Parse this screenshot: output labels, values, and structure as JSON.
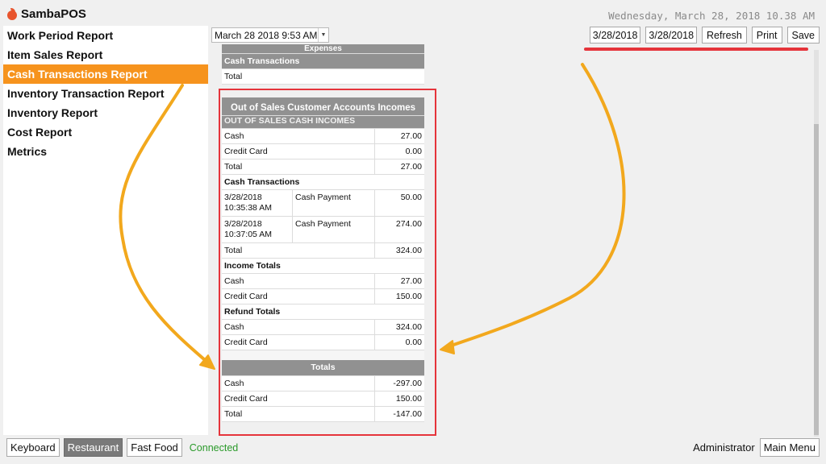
{
  "app": {
    "name": "SambaPOS",
    "datetime": "Wednesday, March 28, 2018 10.38 AM"
  },
  "colors": {
    "accent": "#f6931d",
    "annotation_red": "#e5343b",
    "annotation_arrow": "#f2a81d",
    "header_gray": "#919191",
    "status_green": "#2a9a2a"
  },
  "sidebar": {
    "items": [
      {
        "label": "Work Period Report"
      },
      {
        "label": "Item Sales Report"
      },
      {
        "label": "Cash Transactions Report",
        "active": true
      },
      {
        "label": "Inventory Transaction Report"
      },
      {
        "label": "Inventory Report"
      },
      {
        "label": "Cost Report"
      },
      {
        "label": "Metrics"
      }
    ]
  },
  "work_period_select": {
    "value": "March 28 2018 9:53 AM"
  },
  "toolbar": {
    "start_date": "3/28/2018",
    "end_date": "3/28/2018",
    "refresh": "Refresh",
    "print": "Print",
    "save": "Save"
  },
  "report": {
    "expenses": {
      "title": "Expenses",
      "cash_transactions": "Cash Transactions",
      "total": "Total"
    },
    "title": "Out of Sales Customer Accounts Incomes",
    "subtitle": "OUT OF SALES CASH INCOMES",
    "incomes": [
      {
        "label": "Cash",
        "value": "27.00"
      },
      {
        "label": "Credit Card",
        "value": "0.00"
      },
      {
        "label": "Total",
        "value": "27.00"
      }
    ],
    "cash_transactions_label": "Cash Transactions",
    "cash_transactions": [
      {
        "date": "3/28/2018",
        "time": "10:35:38 AM",
        "desc": "Cash Payment",
        "value": "50.00"
      },
      {
        "date": "3/28/2018",
        "time": "10:37:05 AM",
        "desc": "Cash Payment",
        "value": "274.00"
      }
    ],
    "cash_transactions_total": {
      "label": "Total",
      "value": "324.00"
    },
    "income_totals_label": "Income Totals",
    "income_totals": [
      {
        "label": "Cash",
        "value": "27.00"
      },
      {
        "label": "Credit Card",
        "value": "150.00"
      }
    ],
    "refund_totals_label": "Refund Totals",
    "refund_totals": [
      {
        "label": "Cash",
        "value": "324.00"
      },
      {
        "label": "Credit Card",
        "value": "0.00"
      }
    ],
    "totals_label": "Totals",
    "totals": [
      {
        "label": "Cash",
        "value": "-297.00"
      },
      {
        "label": "Credit Card",
        "value": "150.00"
      },
      {
        "label": "Total",
        "value": "-147.00"
      }
    ]
  },
  "footer": {
    "keyboard": "Keyboard",
    "restaurant": "Restaurant",
    "fast_food": "Fast Food",
    "status": "Connected",
    "user": "Administrator",
    "main_menu": "Main Menu"
  }
}
